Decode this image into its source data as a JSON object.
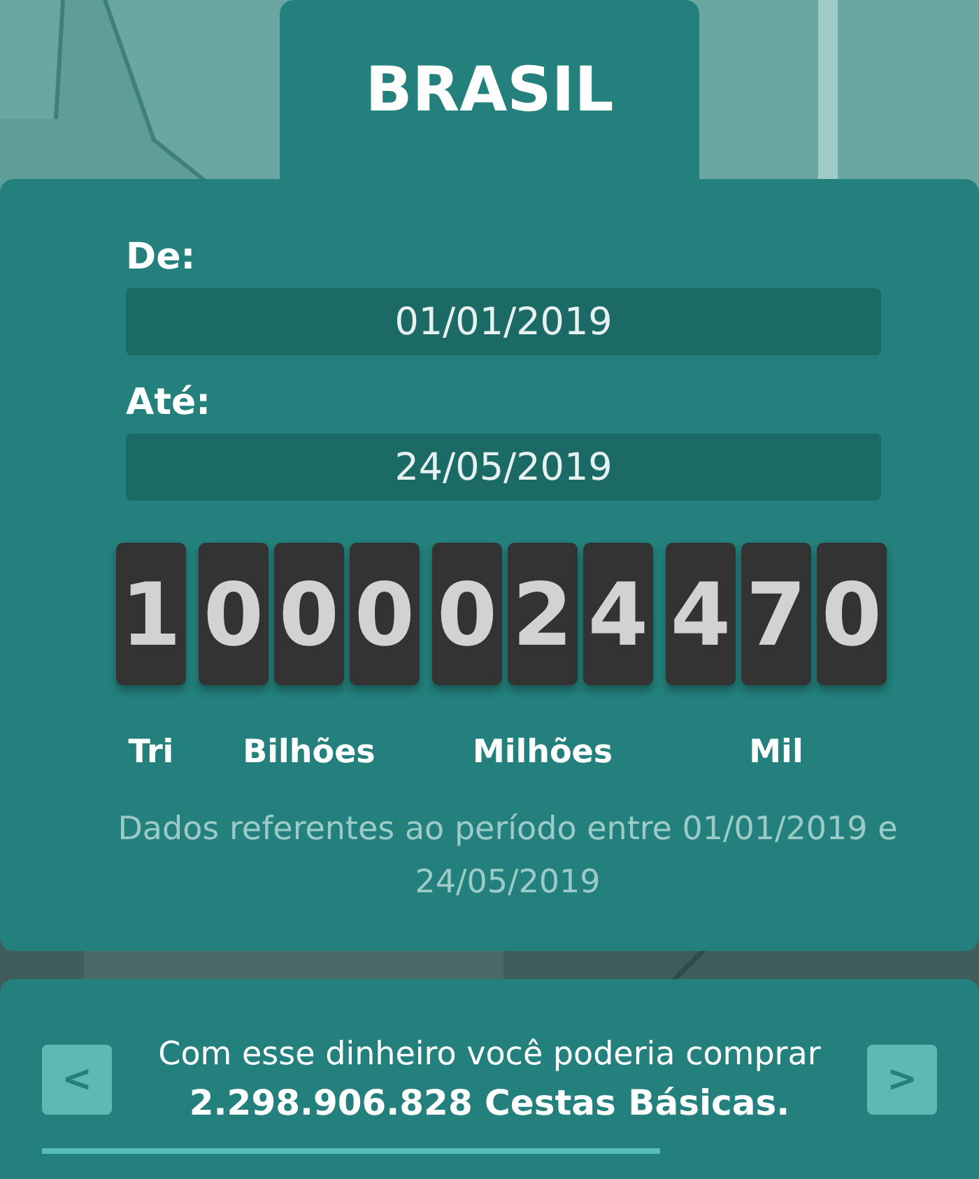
{
  "region": {
    "title": "BRASIL"
  },
  "date_from": {
    "label": "De:",
    "value": "01/01/2019"
  },
  "date_to": {
    "label": "Até:",
    "value": "24/05/2019"
  },
  "counter": {
    "groups": [
      {
        "digits": [
          "1"
        ],
        "label": "Tri"
      },
      {
        "digits": [
          "0",
          "0",
          "0"
        ],
        "label": "Bilhões"
      },
      {
        "digits": [
          "0",
          "2",
          "4"
        ],
        "label": "Milhões"
      },
      {
        "digits": [
          "4",
          "7",
          "0"
        ],
        "label": "Mil"
      }
    ]
  },
  "note": "Dados referentes ao período entre 01/01/2019 e 24/05/2019",
  "carousel": {
    "prev": "<",
    "next": ">",
    "text": "Com esse dinheiro você poderia comprar",
    "highlight": "2.298.906.828 Cestas Básicas."
  }
}
